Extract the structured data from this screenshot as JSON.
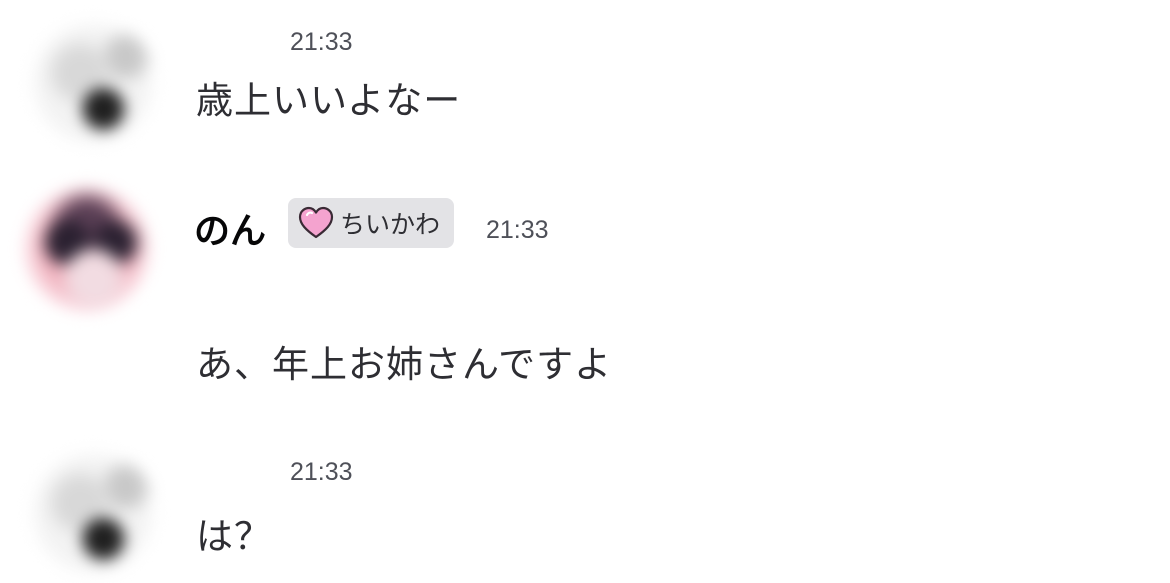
{
  "messages": [
    {
      "time": "21:33",
      "text": "歳上いいよなー"
    },
    {
      "username": "のん",
      "role_tag": "ちいかわ",
      "role_icon": "pink-heart-icon",
      "time": "21:33",
      "text": "あ、年上お姉さんですよ"
    },
    {
      "time": "21:33",
      "text": "は？"
    }
  ]
}
